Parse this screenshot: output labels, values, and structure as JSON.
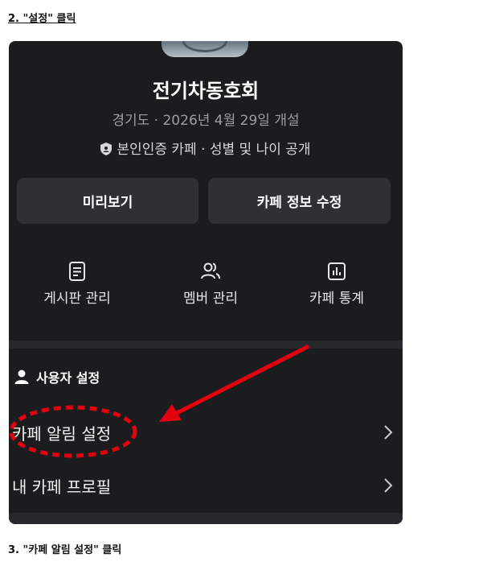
{
  "steps": {
    "step2": "2. \"설정\" 클릭",
    "step3": "3. \"카페 알림 설정\" 클릭"
  },
  "cafe": {
    "name": "전기차동호회",
    "meta": "경기도 · 2026년 4월 29일 개설",
    "badge": "본인인증 카페 · 성별 및 나이 공개"
  },
  "buttons": {
    "preview": "미리보기",
    "edit": "카페 정보 수정"
  },
  "management": [
    {
      "label": "게시판 관리",
      "icon": "document-icon"
    },
    {
      "label": "멤버 관리",
      "icon": "members-icon"
    },
    {
      "label": "카페 통계",
      "icon": "stats-icon"
    }
  ],
  "user_settings": {
    "title": "사용자 설정",
    "items": [
      {
        "label": "카페 알림 설정"
      },
      {
        "label": "내 카페 프로필"
      }
    ]
  },
  "annotation_colors": {
    "highlight": "#e3000f"
  }
}
